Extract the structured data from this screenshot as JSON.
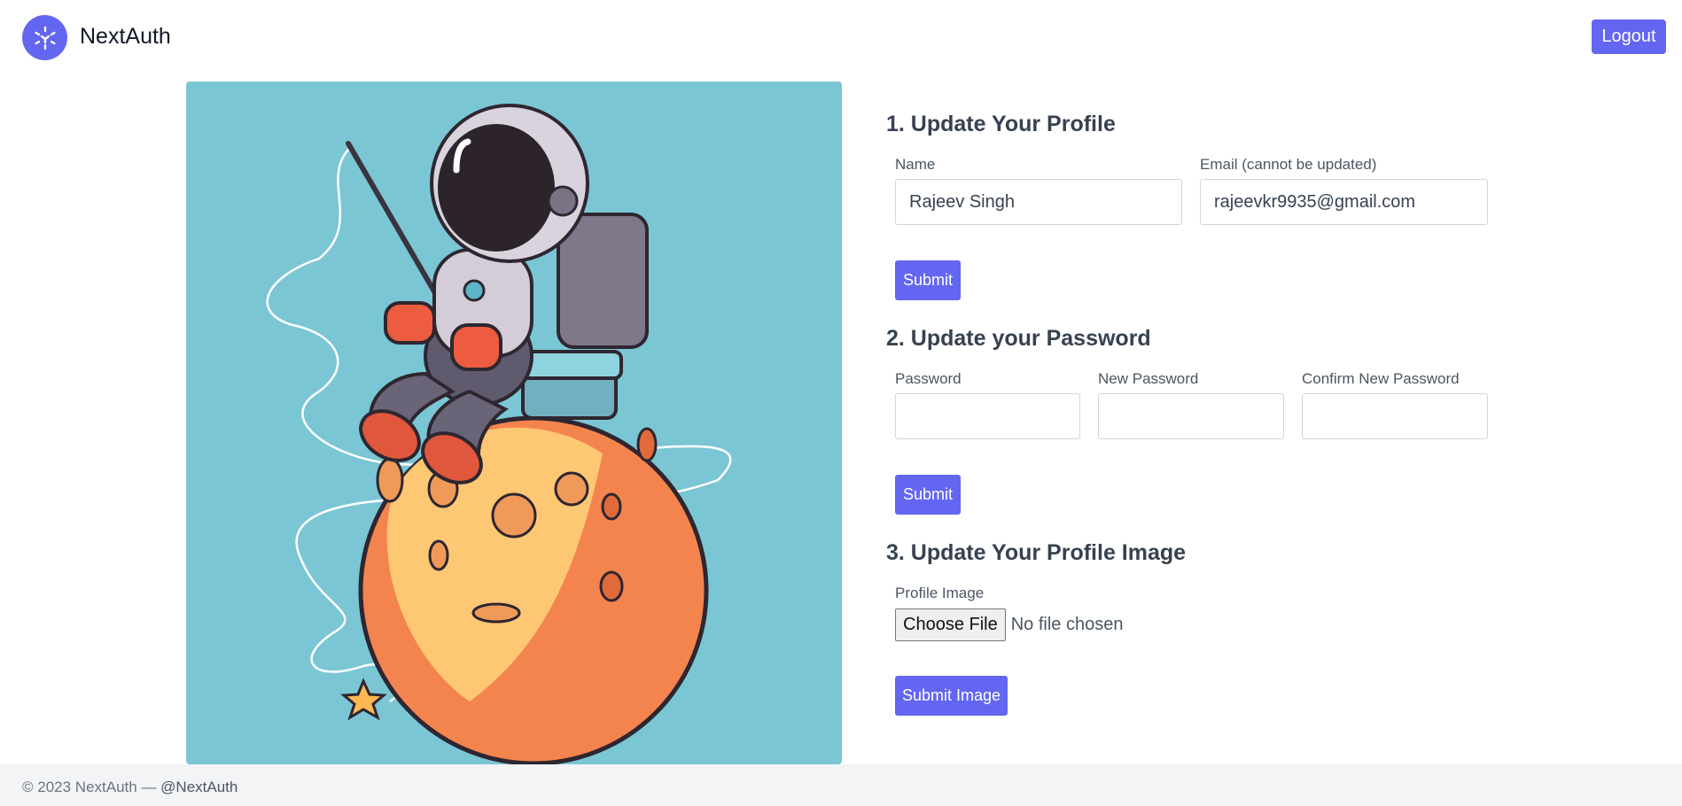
{
  "app": {
    "brand": "NextAuth",
    "logout_label": "Logout"
  },
  "profile_section": {
    "title": "1. Update Your Profile",
    "name_label": "Name",
    "name_value": "Rajeev Singh",
    "email_label": "Email (cannot be updated)",
    "email_value": "rajeevkr9935@gmail.com",
    "submit_label": "Submit"
  },
  "password_section": {
    "title": "2. Update your Password",
    "password_label": "Password",
    "new_password_label": "New Password",
    "confirm_password_label": "Confirm New Password",
    "submit_label": "Submit"
  },
  "image_section": {
    "title": "3. Update Your Profile Image",
    "label": "Profile Image",
    "choose_file_label": "Choose File",
    "file_status": "No file chosen",
    "submit_label": "Submit Image"
  },
  "footer": {
    "copyright": "© 2023 NextAuth — ",
    "handle": "@NextAuth"
  },
  "colors": {
    "accent": "#6366f1",
    "hero_background": "#7bc6d4",
    "footer_background": "#f3f4f6"
  },
  "icons": {
    "logo": "nextauth-logo-icon"
  }
}
